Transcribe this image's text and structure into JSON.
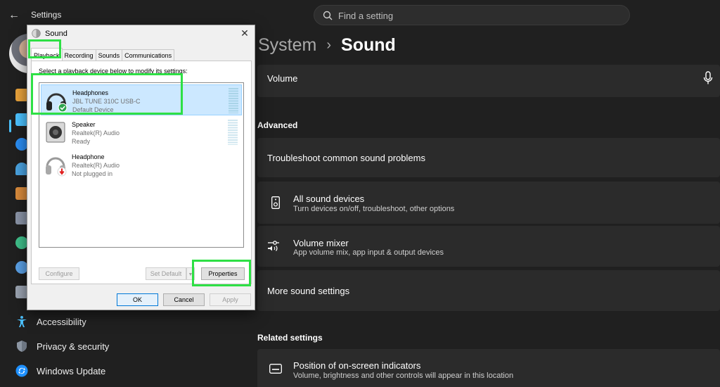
{
  "window": {
    "title": "Settings"
  },
  "search": {
    "placeholder": "Find a setting"
  },
  "sidebar": {
    "items": [
      {
        "label": "Accessibility",
        "icon": "accessibility-icon"
      },
      {
        "label": "Privacy & security",
        "icon": "shield-icon"
      },
      {
        "label": "Windows Update",
        "icon": "windows-update-icon"
      }
    ]
  },
  "breadcrumb": {
    "parent": "System",
    "separator": "›",
    "current": "Sound"
  },
  "main": {
    "volume_label": "Volume",
    "advanced_header": "Advanced",
    "troubleshoot": "Troubleshoot common sound problems",
    "all_devices": {
      "title": "All sound devices",
      "subtitle": "Turn devices on/off, troubleshoot, other options"
    },
    "volume_mixer": {
      "title": "Volume mixer",
      "subtitle": "App volume mix, app input & output devices"
    },
    "more_settings": "More sound settings",
    "related_header": "Related settings",
    "indicators": {
      "title": "Position of on-screen indicators",
      "subtitle": "Volume, brightness and other controls will appear in this location"
    }
  },
  "dialog": {
    "title": "Sound",
    "tabs": [
      "Playback",
      "Recording",
      "Sounds",
      "Communications"
    ],
    "instruction": "Select a playback device below to modify its settings:",
    "devices": [
      {
        "name": "Headphones",
        "model": "JBL TUNE 310C USB-C",
        "status": "Default Device",
        "badge": "check"
      },
      {
        "name": "Speaker",
        "model": "Realtek(R) Audio",
        "status": "Ready",
        "badge": "none"
      },
      {
        "name": "Headphone",
        "model": "Realtek(R) Audio",
        "status": "Not plugged in",
        "badge": "down-arrow"
      }
    ],
    "buttons": {
      "configure": "Configure",
      "set_default": "Set Default",
      "properties": "Properties",
      "ok": "OK",
      "cancel": "Cancel",
      "apply": "Apply"
    }
  },
  "colors": {
    "accent": "#4cc2ff",
    "highlight": "#2ee045",
    "selected_row": "#cce8ff",
    "check_badge": "#2da44e",
    "unplugged_badge": "#e02020"
  }
}
